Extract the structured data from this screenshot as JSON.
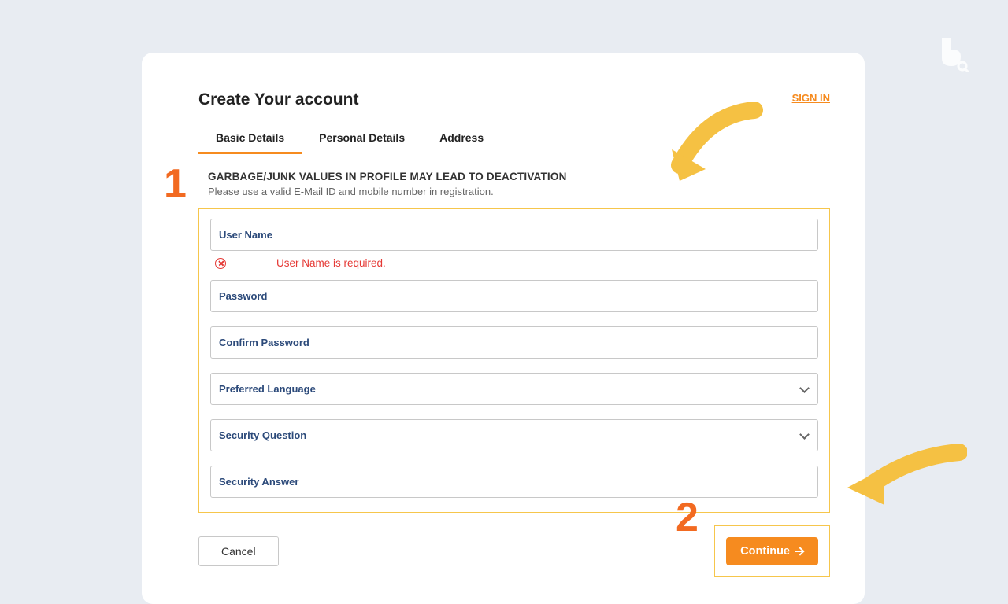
{
  "header": {
    "title": "Create Your account",
    "sign_in": "SIGN IN"
  },
  "tabs": [
    {
      "label": "Basic Details",
      "active": true
    },
    {
      "label": "Personal Details",
      "active": false
    },
    {
      "label": "Address",
      "active": false
    }
  ],
  "warning": {
    "title": "GARBAGE/JUNK VALUES IN PROFILE MAY LEAD TO DEACTIVATION",
    "subtitle": "Please use a valid E-Mail ID and mobile number in registration."
  },
  "fields": {
    "username": {
      "label": "User Name",
      "error": "User Name is required."
    },
    "password": {
      "label": "Password"
    },
    "confirm_password": {
      "label": "Confirm Password"
    },
    "preferred_language": {
      "label": "Preferred Language"
    },
    "security_question": {
      "label": "Security Question"
    },
    "security_answer": {
      "label": "Security Answer"
    }
  },
  "buttons": {
    "cancel": "Cancel",
    "continue": "Continue"
  },
  "annotations": {
    "step1": "1",
    "step2": "2"
  },
  "colors": {
    "accent": "#f68b1f",
    "highlight_border": "#f6c64c",
    "error": "#e53935",
    "arrow": "#f5c143"
  }
}
